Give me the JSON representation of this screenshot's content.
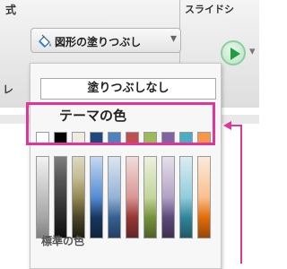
{
  "ribbon": {
    "left_tab": "式",
    "right_tab": "スライドシ",
    "fill_button_label": "図形の塗りつぶし",
    "side_label": "レ"
  },
  "menu": {
    "no_fill_label": "塗りつぶしなし",
    "theme_colors_title": "テーマの色",
    "footer_label": "標準の色"
  },
  "colors": {
    "highlight": "#e0369a",
    "theme_swatches": [
      "#ffffff",
      "#000000",
      "#eeece1",
      "#1f497d",
      "#4f81bd",
      "#c0504d",
      "#9bbb59",
      "#8064a2",
      "#4bacc6",
      "#f79646"
    ]
  },
  "icons": {
    "paint_bucket": "paint-bucket-icon",
    "dropdown": "chevron-down-icon",
    "play": "play-icon",
    "callout_arrow": "arrow-left-icon"
  }
}
